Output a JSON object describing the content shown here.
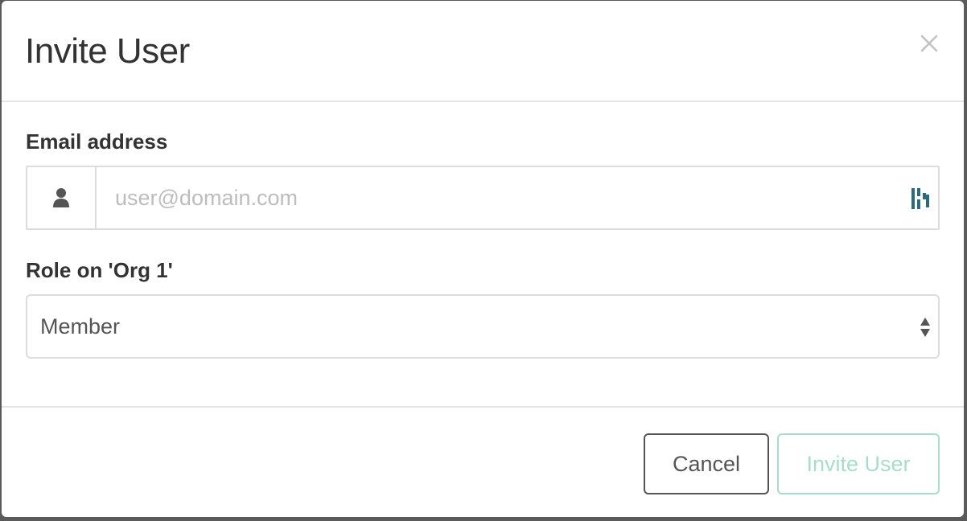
{
  "modal": {
    "title": "Invite User",
    "close_icon": "close-icon"
  },
  "email": {
    "label": "Email address",
    "placeholder": "user@domain.com",
    "value": "",
    "addon_icon": "user-icon",
    "password_manager_icon": "password-manager-icon"
  },
  "role": {
    "label": "Role on 'Org 1'",
    "selected": "Member",
    "arrow_icon": "select-arrows-icon"
  },
  "footer": {
    "cancel_label": "Cancel",
    "invite_label": "Invite User"
  },
  "colors": {
    "text_primary": "#333333",
    "text_secondary": "#555555",
    "placeholder": "#bdbdbd",
    "border": "#dcdcdc",
    "divider": "#e5e5e5",
    "invite_disabled": "#a8dccb",
    "password_manager": "#2d6b7c",
    "backdrop": "#5a5a5a"
  }
}
